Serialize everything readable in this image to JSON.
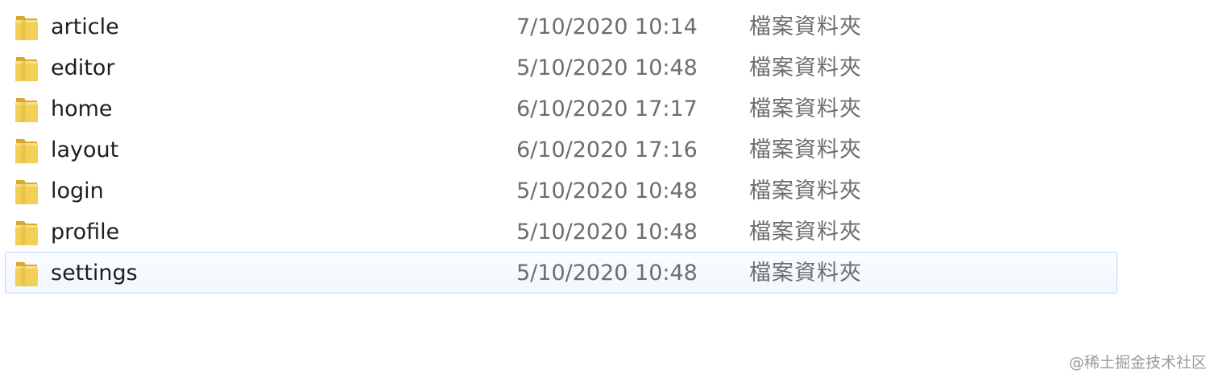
{
  "files": [
    {
      "name": "article",
      "date": "7/10/2020 10:14",
      "type": "檔案資料夾",
      "icon": "folder-icon",
      "selected": false
    },
    {
      "name": "editor",
      "date": "5/10/2020 10:48",
      "type": "檔案資料夾",
      "icon": "folder-icon",
      "selected": false
    },
    {
      "name": "home",
      "date": "6/10/2020 17:17",
      "type": "檔案資料夾",
      "icon": "folder-icon",
      "selected": false
    },
    {
      "name": "layout",
      "date": "6/10/2020 17:16",
      "type": "檔案資料夾",
      "icon": "folder-icon",
      "selected": false
    },
    {
      "name": "login",
      "date": "5/10/2020 10:48",
      "type": "檔案資料夾",
      "icon": "folder-icon",
      "selected": false
    },
    {
      "name": "profile",
      "date": "5/10/2020 10:48",
      "type": "檔案資料夾",
      "icon": "folder-icon",
      "selected": false
    },
    {
      "name": "settings",
      "date": "5/10/2020 10:48",
      "type": "檔案資料夾",
      "icon": "folder-icon",
      "selected": true
    }
  ],
  "watermark": "@稀土掘金技术社区",
  "colors": {
    "selection_border": "#b8d6fb",
    "selection_fill": "#f1f7fe",
    "folder_yellow": "#f2cf56"
  }
}
